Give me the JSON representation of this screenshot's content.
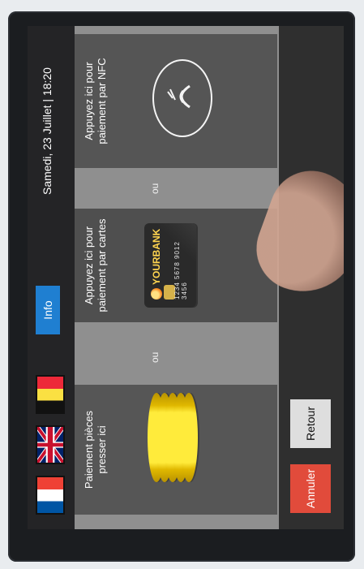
{
  "header": {
    "info_label": "Info",
    "datetime": "Samedi, 23 Juillet | 18:20",
    "languages": [
      "FR",
      "EN",
      "BE"
    ]
  },
  "panels": {
    "coins_label": "Paiement pièces presser ici",
    "cards_label": "Appuyez ici pour paiement par cartes",
    "nfc_label": "Appuyez ici pour paiement par NFC",
    "or_label_1": "ou",
    "or_label_2": "ou"
  },
  "card": {
    "brand": "YOURBANK",
    "number": "1234  5678  9012  3456"
  },
  "footer": {
    "cancel_label": "Annuler",
    "back_label": "Retour"
  },
  "colors": {
    "info": "#1f7fd1",
    "cancel": "#e14b3b",
    "back": "#dedede",
    "panel_bg": "#4f4f4f",
    "background": "#8f8f8f"
  },
  "icons": [
    "uk-flag-icon",
    "france-flag-icon",
    "belgium-flag-icon",
    "nfc-icon",
    "card-icon",
    "coin-stack-icon"
  ]
}
